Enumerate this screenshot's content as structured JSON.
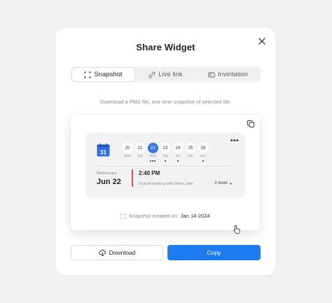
{
  "dialog": {
    "title": "Share Widget",
    "description": "Download a PNG file, one time snapshot of selected tile."
  },
  "tabs": [
    {
      "label": "Snapshot",
      "icon": "snapshot-icon",
      "active": true
    },
    {
      "label": "Live link",
      "icon": "link-icon",
      "active": false
    },
    {
      "label": "Invintation",
      "icon": "envelope-icon",
      "active": false
    }
  ],
  "preview": {
    "calendar_icon_label": "31",
    "days": [
      {
        "num": "20",
        "name": "Mon"
      },
      {
        "num": "21",
        "name": "Tue"
      },
      {
        "num": "22",
        "name": "Wed"
      },
      {
        "num": "23",
        "name": "Thu"
      },
      {
        "num": "24",
        "name": "Fri"
      },
      {
        "num": "25",
        "name": "Sat"
      },
      {
        "num": "26",
        "name": "Sun"
      }
    ],
    "weekday": "Wednesday",
    "date": "Jun 22",
    "event_time": "2:40 PM",
    "event_title": "Kickoff meeting with Steve Jobs",
    "more_label": "2 more",
    "created_label": "Snapshot created on:",
    "created_date": "Jan 14-2024"
  },
  "actions": {
    "download_label": "Download",
    "copy_label": "Copy"
  },
  "colors": {
    "accent": "#1e7cf2",
    "selected_day": "#3578e5",
    "event_bar": "#e0474c"
  }
}
